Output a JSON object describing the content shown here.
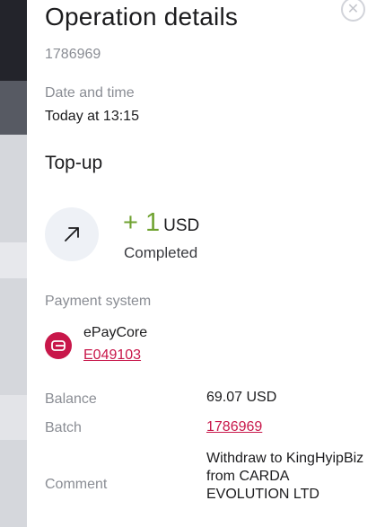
{
  "title": "Operation details",
  "operation_id": "1786969",
  "date_label": "Date and time",
  "date_value": "Today at 13:15",
  "section_title": "Top-up",
  "amount": {
    "value": "+ 1",
    "currency": "USD",
    "status": "Completed",
    "color": "#6fa230"
  },
  "payment": {
    "label": "Payment system",
    "name": "ePayCore",
    "code": "E049103",
    "icon": "epaycore-logo-icon",
    "color": "#c8174a"
  },
  "details": {
    "balance_label": "Balance",
    "balance_value": "69.07 USD",
    "batch_label": "Batch",
    "batch_value": "1786969",
    "comment_label": "Comment",
    "comment_value": "Withdraw to KingHyipBiz from CARDA EVOLUTION LTD"
  },
  "icons": {
    "close": "close-icon",
    "direction": "arrow-up-right-icon"
  }
}
